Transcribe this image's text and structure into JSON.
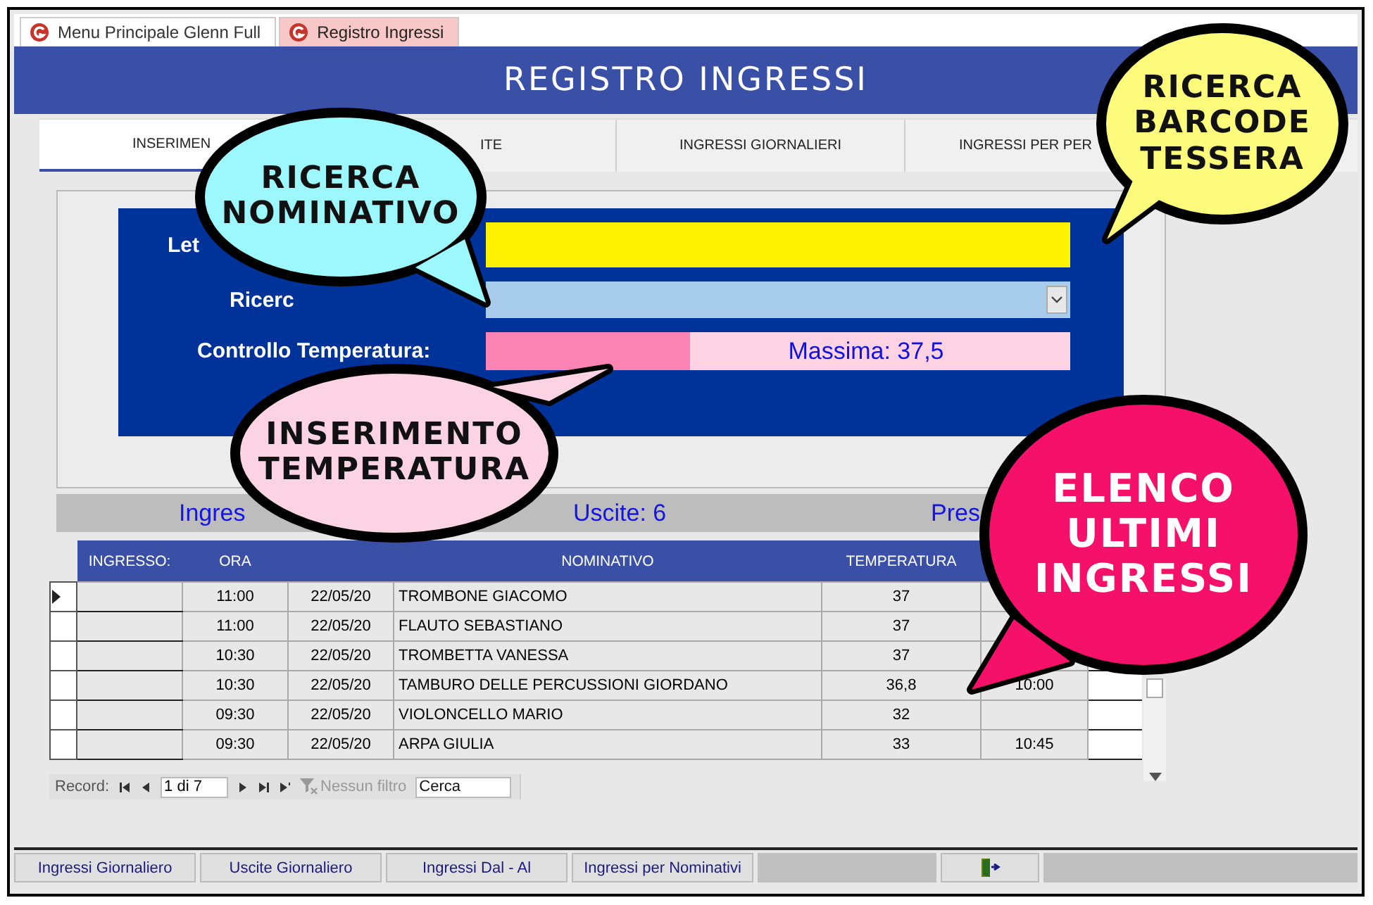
{
  "document_tabs": [
    {
      "label": "Menu Principale Glenn Full",
      "selected": false
    },
    {
      "label": "Registro Ingressi",
      "selected": true
    }
  ],
  "title": "REGISTRO INGRESSI",
  "form_tabs": [
    {
      "label": "INSERIMEN",
      "selected": true
    },
    {
      "label": "ITE",
      "selected": false
    },
    {
      "label": "INGRESSI GIORNALIERI",
      "selected": false
    },
    {
      "label": "INGRESSI PER PER",
      "selected": false
    }
  ],
  "entry_panel": {
    "fields": [
      {
        "kind": "barcode",
        "label": "Let"
      },
      {
        "kind": "combo",
        "label": "Ricerc"
      },
      {
        "kind": "temperature",
        "label": "Controllo Temperatura:",
        "value": "Massima: 37,5",
        "level": 0.35
      }
    ]
  },
  "summary": [
    "Ingres",
    "Uscite: 6",
    "Pres"
  ],
  "table": {
    "columns": {
      "ingresso": "INGRESSO:",
      "ora": "ORA",
      "nominativo": "NOMINATIVO",
      "temperatura": "TEMPERATURA"
    },
    "rows": [
      {
        "selected": true,
        "ora": "11:00",
        "data": "22/05/20",
        "nominativo": "TROMBONE GIACOMO",
        "temperatura": "37"
      },
      {
        "selected": false,
        "ora": "11:00",
        "data": "22/05/20",
        "nominativo": "FLAUTO SEBASTIANO",
        "temperatura": "37"
      },
      {
        "selected": false,
        "ora": "10:30",
        "data": "22/05/20",
        "nominativo": "TROMBETTA VANESSA",
        "temperatura": "37"
      },
      {
        "selected": false,
        "ora": "10:30",
        "data": "22/05/20",
        "nominativo": "TAMBURO DELLE PERCUSSIONI GIORDANO",
        "temperatura": "36,8",
        "column_6": "10:00"
      },
      {
        "selected": false,
        "ora": "09:30",
        "data": "22/05/20",
        "nominativo": "VIOLONCELLO MARIO",
        "temperatura": "32"
      },
      {
        "selected": false,
        "ora": "09:30",
        "data": "22/05/20",
        "nominativo": "ARPA GIULIA",
        "temperatura": "33",
        "column_6": "10:45"
      }
    ]
  },
  "navigation": {
    "label": "Record:",
    "position": "1 di 7",
    "filter": {
      "label": "Nessun filtro",
      "disabled": true
    },
    "search": {
      "placeholder": "Cerca"
    }
  },
  "bottom_buttons": [
    {
      "kind": "text",
      "label": "Ingressi Giornaliero"
    },
    {
      "kind": "text",
      "label": "Uscite Giornaliero"
    },
    {
      "kind": "text",
      "label": "Ingressi Dal - Al"
    },
    {
      "kind": "text",
      "label": "Ingressi per Nominativi"
    },
    {
      "kind": "spacer"
    },
    {
      "kind": "exit"
    },
    {
      "kind": "spacer"
    }
  ],
  "callouts": [
    {
      "lines": [
        "RICERCA",
        "NOMINATIVO"
      ],
      "color": "#9cf8fc"
    },
    {
      "lines": [
        "RICERCA",
        "BARCODE",
        "TESSERA"
      ],
      "color": "#fcfb7c"
    },
    {
      "lines": [
        "INSERIMENTO",
        "TEMPERATURA"
      ],
      "color": "#fcd3e3"
    },
    {
      "lines": [
        "ELENCO",
        "ULTIMI",
        "INGRESSI"
      ],
      "color": "#f5106a"
    }
  ]
}
